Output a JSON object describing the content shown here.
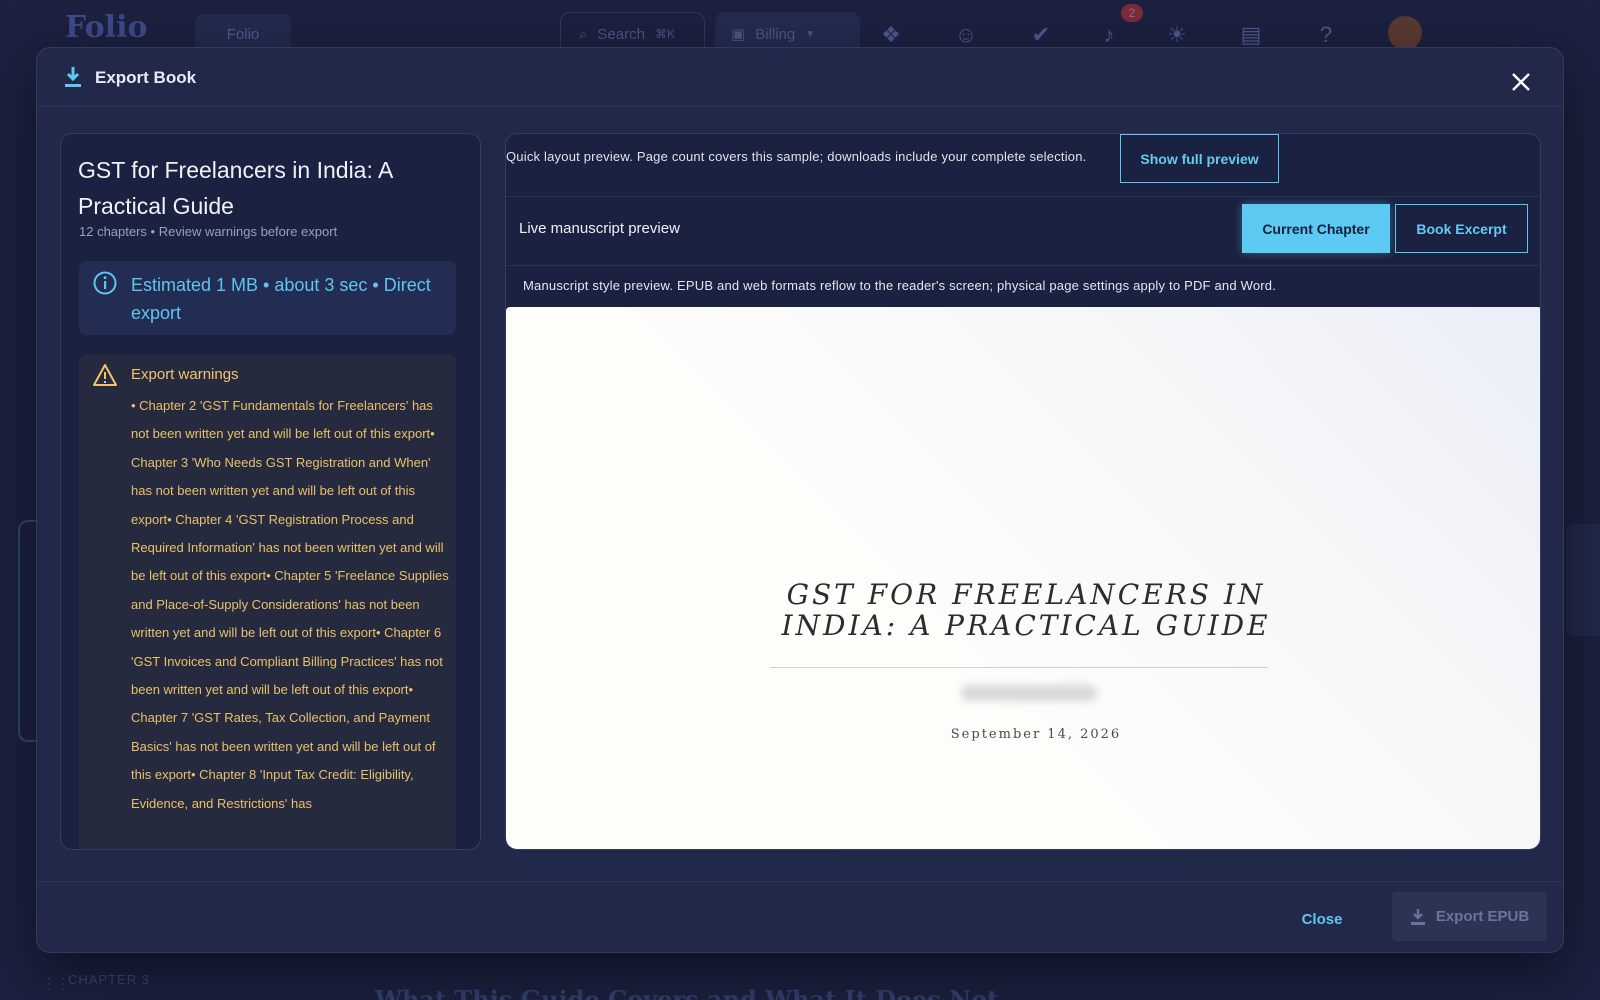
{
  "background": {
    "logo": "Folio",
    "workspace_chip": "Folio",
    "search_placeholder": "Search",
    "search_shortcut": "⌘K",
    "billing_label": "Billing",
    "notifications_count": "2",
    "chapter_label": "CHAPTER 3",
    "chapter_heading": "What This Guide Covers and What It Does Not"
  },
  "modal": {
    "title": "Export Book",
    "close_label": "Close",
    "export_label": "Export EPUB"
  },
  "book": {
    "title": "GST for Freelancers in India: A Practical Guide",
    "subtitle": "12 chapters • Review warnings before export"
  },
  "estimate": {
    "text": "Estimated 1 MB • about 3 sec • Direct export"
  },
  "warnings": {
    "title": "Export warnings",
    "body": "• Chapter 2 'GST Fundamentals for Freelancers' has not been written yet and will be left out of this export• Chapter 3 'Who Needs GST Registration and When' has not been written yet and will be left out of this export• Chapter 4 'GST Registration Process and Required Information' has not been written yet and will be left out of this export• Chapter 5 'Freelance Supplies and Place-of-Supply Considerations' has not been written yet and will be left out of this export• Chapter 6 'GST Invoices and Compliant Billing Practices' has not been written yet and will be left out of this export• Chapter 7 'GST Rates, Tax Collection, and Payment Basics' has not been written yet and will be left out of this export• Chapter 8 'Input Tax Credit: Eligibility, Evidence, and Restrictions' has"
  },
  "preview": {
    "note": "Quick layout preview. Page count covers this sample; downloads include your complete selection.",
    "show_full_label": "Show full preview",
    "live_label": "Live manuscript preview",
    "tab_current": "Current Chapter",
    "tab_excerpt": "Book Excerpt",
    "style_note": "Manuscript style preview. EPUB and web formats reflow to the reader's screen; physical page settings apply to PDF and Word.",
    "page_title": "GST for Freelancers in India: A Practical Guide",
    "page_date": "September 14, 2026"
  },
  "colors": {
    "accent": "#5ccaf2",
    "warning": "#f2c56a",
    "modal_bg": "#21284a"
  }
}
